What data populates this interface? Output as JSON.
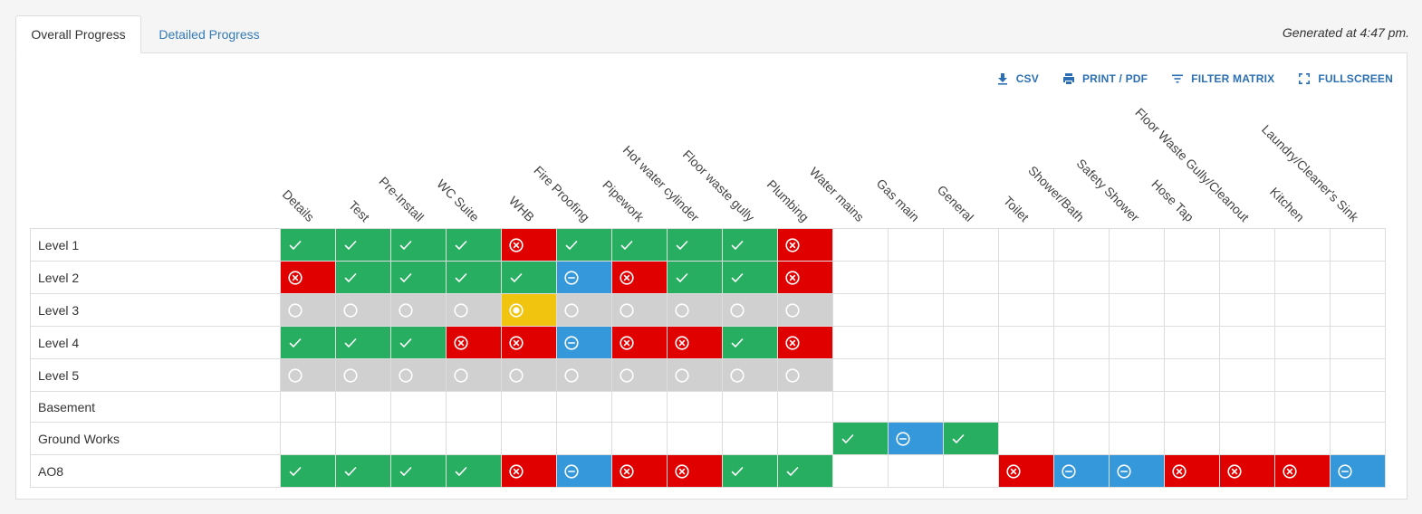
{
  "tabs": [
    {
      "label": "Overall Progress",
      "active": true
    },
    {
      "label": "Detailed Progress",
      "active": false
    }
  ],
  "generated_text": "Generated at 4:47 pm.",
  "actions": [
    {
      "label": "CSV",
      "icon": "download-icon"
    },
    {
      "label": "PRINT / PDF",
      "icon": "printer-icon"
    },
    {
      "label": "FILTER MATRIX",
      "icon": "filter-icon"
    },
    {
      "label": "FULLSCREEN",
      "icon": "fullscreen-icon"
    }
  ],
  "colors": {
    "ok": "#27ae60",
    "fail": "#e00000",
    "na": "#3498db",
    "pending": "#d0d0d0",
    "in_progress": "#f1c40f"
  },
  "columns": [
    "Details",
    "Test",
    "Pre-Install",
    "WC Suite",
    "WHB",
    "Fire Proofing",
    "Pipework",
    "Hot water cylinder",
    "Floor waste gully",
    "Plumbing",
    "Water mains",
    "Gas main",
    "General",
    "Toilet",
    "Shower/Bath",
    "Safety Shower",
    "Hose Tap",
    "Floor Waste Gully/Cleanout",
    "Kitchen",
    "Laundry/Cleaner's Sink"
  ],
  "rows": [
    {
      "label": "Level 1",
      "cells": [
        "ok",
        "ok",
        "ok",
        "ok",
        "fail",
        "ok",
        "ok",
        "ok",
        "ok",
        "fail",
        "",
        "",
        "",
        "",
        "",
        "",
        "",
        "",
        "",
        ""
      ]
    },
    {
      "label": "Level 2",
      "cells": [
        "fail",
        "ok",
        "ok",
        "ok",
        "ok",
        "na",
        "fail",
        "ok",
        "ok",
        "fail",
        "",
        "",
        "",
        "",
        "",
        "",
        "",
        "",
        "",
        ""
      ]
    },
    {
      "label": "Level 3",
      "cells": [
        "pending",
        "pending",
        "pending",
        "pending",
        "in_progress",
        "pending",
        "pending",
        "pending",
        "pending",
        "pending",
        "",
        "",
        "",
        "",
        "",
        "",
        "",
        "",
        "",
        ""
      ]
    },
    {
      "label": "Level 4",
      "cells": [
        "ok",
        "ok",
        "ok",
        "fail",
        "fail",
        "na",
        "fail",
        "fail",
        "ok",
        "fail",
        "",
        "",
        "",
        "",
        "",
        "",
        "",
        "",
        "",
        ""
      ]
    },
    {
      "label": "Level 5",
      "cells": [
        "pending",
        "pending",
        "pending",
        "pending",
        "pending",
        "pending",
        "pending",
        "pending",
        "pending",
        "pending",
        "",
        "",
        "",
        "",
        "",
        "",
        "",
        "",
        "",
        ""
      ]
    },
    {
      "label": "Basement",
      "cells": [
        "",
        "",
        "",
        "",
        "",
        "",
        "",
        "",
        "",
        "",
        "",
        "",
        "",
        "",
        "",
        "",
        "",
        "",
        "",
        ""
      ]
    },
    {
      "label": "Ground Works",
      "cells": [
        "",
        "",
        "",
        "",
        "",
        "",
        "",
        "",
        "",
        "",
        "ok",
        "na",
        "ok",
        "",
        "",
        "",
        "",
        "",
        "",
        ""
      ]
    },
    {
      "label": "AO8",
      "cells": [
        "ok",
        "ok",
        "ok",
        "ok",
        "fail",
        "na",
        "fail",
        "fail",
        "ok",
        "ok",
        "",
        "",
        "",
        "fail",
        "na",
        "na",
        "fail",
        "fail",
        "fail",
        "na"
      ]
    }
  ]
}
